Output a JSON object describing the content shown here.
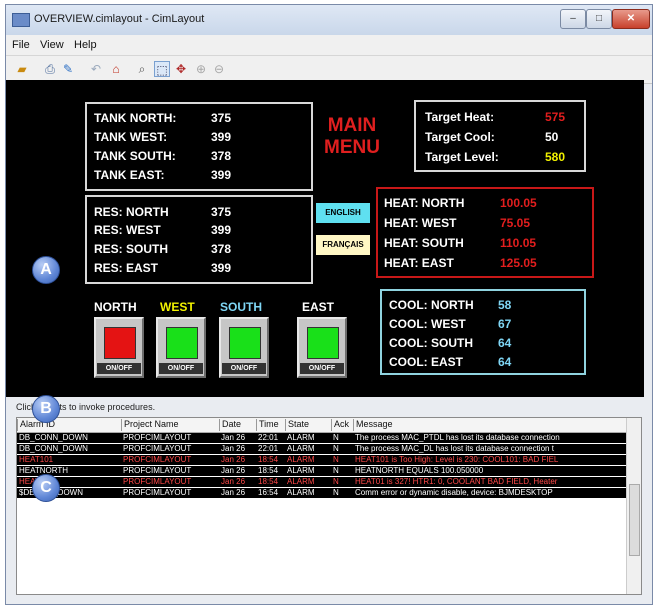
{
  "window": {
    "title": "OVERVIEW.cimlayout - CimLayout",
    "controls": {
      "minimize": "–",
      "maximize": "□",
      "close": "✕"
    }
  },
  "menu": [
    "File",
    "View",
    "Help"
  ],
  "toolbar_icons": [
    "open-folder-icon",
    "print-preview-icon",
    "properties-icon",
    "undo-arrow-icon",
    "home-icon",
    "search-icon",
    "select-tool-icon",
    "pan-tool-icon",
    "zoom-in-icon",
    "zoom-out-icon"
  ],
  "screen": {
    "tanks": [
      {
        "label": "TANK NORTH:",
        "value": "375"
      },
      {
        "label": "TANK WEST:",
        "value": "399"
      },
      {
        "label": "TANK SOUTH:",
        "value": "378"
      },
      {
        "label": "TANK EAST:",
        "value": "399"
      }
    ],
    "res": [
      {
        "label": "RES: NORTH",
        "value": "375"
      },
      {
        "label": "RES: WEST",
        "value": "399"
      },
      {
        "label": "RES: SOUTH",
        "value": "378"
      },
      {
        "label": "RES: EAST",
        "value": "399"
      }
    ],
    "main_menu_line1": "MAIN",
    "main_menu_line2": "MENU",
    "targets": [
      {
        "label": "Target Heat:",
        "value": "575",
        "color": "#e21e1e"
      },
      {
        "label": "Target Cool:",
        "value": "50",
        "color": "#ffffff"
      },
      {
        "label": "Target Level:",
        "value": "580",
        "color": "#f2f200"
      }
    ],
    "lang_english": "ENGLISH",
    "lang_francais": "FRANÇAIS",
    "heat": [
      {
        "label": "HEAT: NORTH",
        "value": "100.05"
      },
      {
        "label": "HEAT: WEST",
        "value": "75.05"
      },
      {
        "label": "HEAT: SOUTH",
        "value": "110.05"
      },
      {
        "label": "HEAT: EAST",
        "value": "125.05"
      }
    ],
    "cool": [
      {
        "label": "COOL: NORTH",
        "value": "58"
      },
      {
        "label": "COOL: WEST",
        "value": "67"
      },
      {
        "label": "COOL: SOUTH",
        "value": "64"
      },
      {
        "label": "COOL: EAST",
        "value": "64"
      }
    ],
    "directions": [
      {
        "label": "NORTH",
        "color": "#ffffff",
        "lamp": "#e41313"
      },
      {
        "label": "WEST",
        "color": "#f2f200",
        "lamp": "#19e019"
      },
      {
        "label": "SOUTH",
        "color": "#7fd6f5",
        "lamp": "#19e019"
      },
      {
        "label": "EAST",
        "color": "#ffffff",
        "lamp": "#19e019"
      }
    ],
    "onoff_label": "ON/OFF"
  },
  "markers": {
    "a": "A",
    "b": "B",
    "c": "C"
  },
  "status_text": "Click objects to invoke procedures.",
  "alarm_table": {
    "columns": [
      "Alarm ID",
      "Project Name",
      "Date",
      "Time",
      "State",
      "Ack",
      "Message"
    ],
    "rows": [
      {
        "id": "DB_CONN_DOWN",
        "project": "PROFCIMLAYOUT",
        "date": "Jan 26",
        "time": "22:01",
        "state": "ALARM",
        "ack": "N",
        "message": "The process MAC_PTDL has lost its database connection",
        "color": "#ffffff"
      },
      {
        "id": "DB_CONN_DOWN",
        "project": "PROFCIMLAYOUT",
        "date": "Jan 26",
        "time": "22:01",
        "state": "ALARM",
        "ack": "N",
        "message": "The process MAC_DL has lost its database connection t",
        "color": "#ffffff"
      },
      {
        "id": "HEAT101",
        "project": "PROFCIMLAYOUT",
        "date": "Jan 26",
        "time": "18:54",
        "state": "ALARM",
        "ack": "N",
        "message": "HEAT101 is Too High: Level is 230: COOL101: BAD FIEL",
        "color": "#ff4a4a"
      },
      {
        "id": "HEATNORTH",
        "project": "PROFCIMLAYOUT",
        "date": "Jan 26",
        "time": "18:54",
        "state": "ALARM",
        "ack": "N",
        "message": "HEATNORTH EQUALS 100.050000",
        "color": "#ffffff"
      },
      {
        "id": "HEAT01",
        "project": "PROFCIMLAYOUT",
        "date": "Jan 26",
        "time": "18:54",
        "state": "ALARM",
        "ack": "N",
        "message": "HEAT01 is 327! HTR1: 0, COOLANT BAD FIELD, Heater",
        "color": "#ff4a4a"
      },
      {
        "id": "$DEVICE_DOWN",
        "project": "PROFCIMLAYOUT",
        "date": "Jan 26",
        "time": "16:54",
        "state": "ALARM",
        "ack": "N",
        "message": "Comm error or dynamic disable, device: BJMDESKTOP",
        "color": "#ffffff"
      }
    ]
  }
}
